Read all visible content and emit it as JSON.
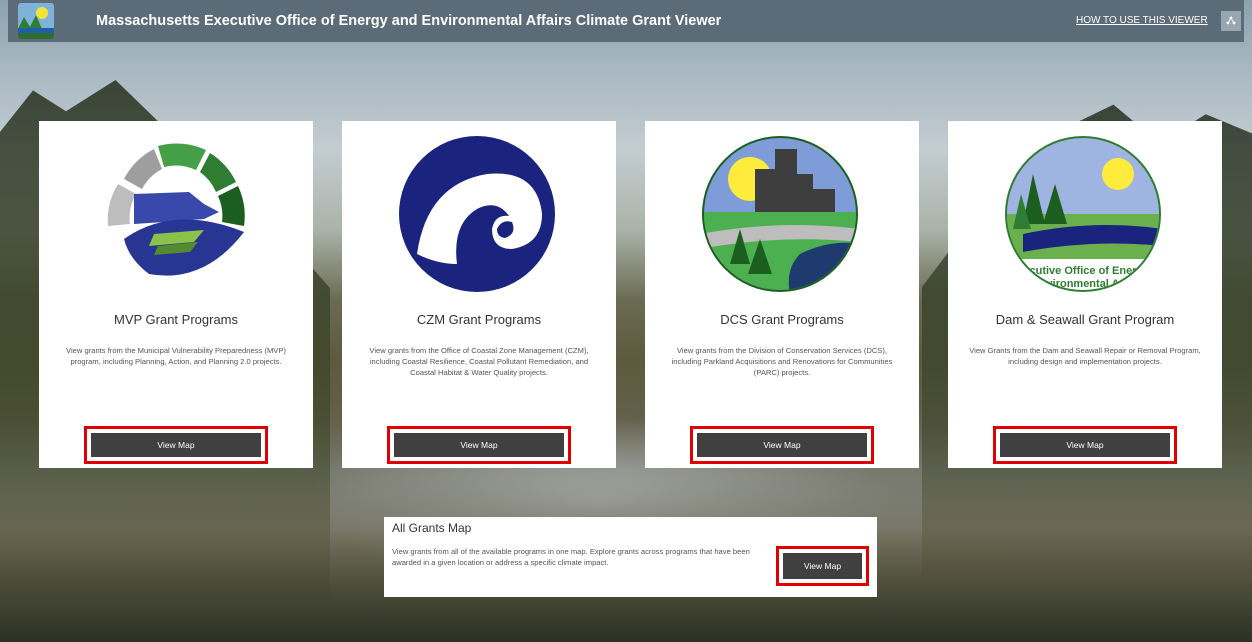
{
  "header": {
    "title": "Massachusetts Executive Office of Energy and Environmental Affairs Climate Grant Viewer",
    "help_link": "HOW TO USE THIS VIEWER",
    "menu_icon": "share-icon"
  },
  "cards": [
    {
      "title": "MVP Grant Programs",
      "description": "View grants from the Municipal Vulnerability Preparedness (MVP) program, including Planning, Action, and Planning 2.0 projects.",
      "button": "View Map"
    },
    {
      "title": "CZM Grant Programs",
      "description": "View grants from the Office of Coastal Zone Management (CZM), including Coastal Resilience, Coastal Pollutant Remediation, and Coastal Habitat & Water Quality projects.",
      "button": "View Map"
    },
    {
      "title": "DCS Grant Programs",
      "description": "View grants from the Division of Conservation Services (DCS), including Parkland Acquisitions and Renovations for Communities (PARC) projects.",
      "button": "View Map"
    },
    {
      "title": "Dam & Seawall Grant Program",
      "description": "View Grants from the Dam and Seawall Repair or Removal Program, including design and implementation projects.",
      "button": "View Map",
      "logo_text_1": "cutive Office of Ener",
      "logo_text_2": "vironmental A"
    }
  ],
  "all_grants": {
    "title": "All Grants Map",
    "description": "View grants from all of the available programs in one map. Explore grants across programs that have been awarded in a given location or address a specific climate impact.",
    "button": "View Map"
  },
  "colors": {
    "header_bg": "#5b6b78",
    "button_bg": "#404040",
    "highlight": "#e00000"
  }
}
